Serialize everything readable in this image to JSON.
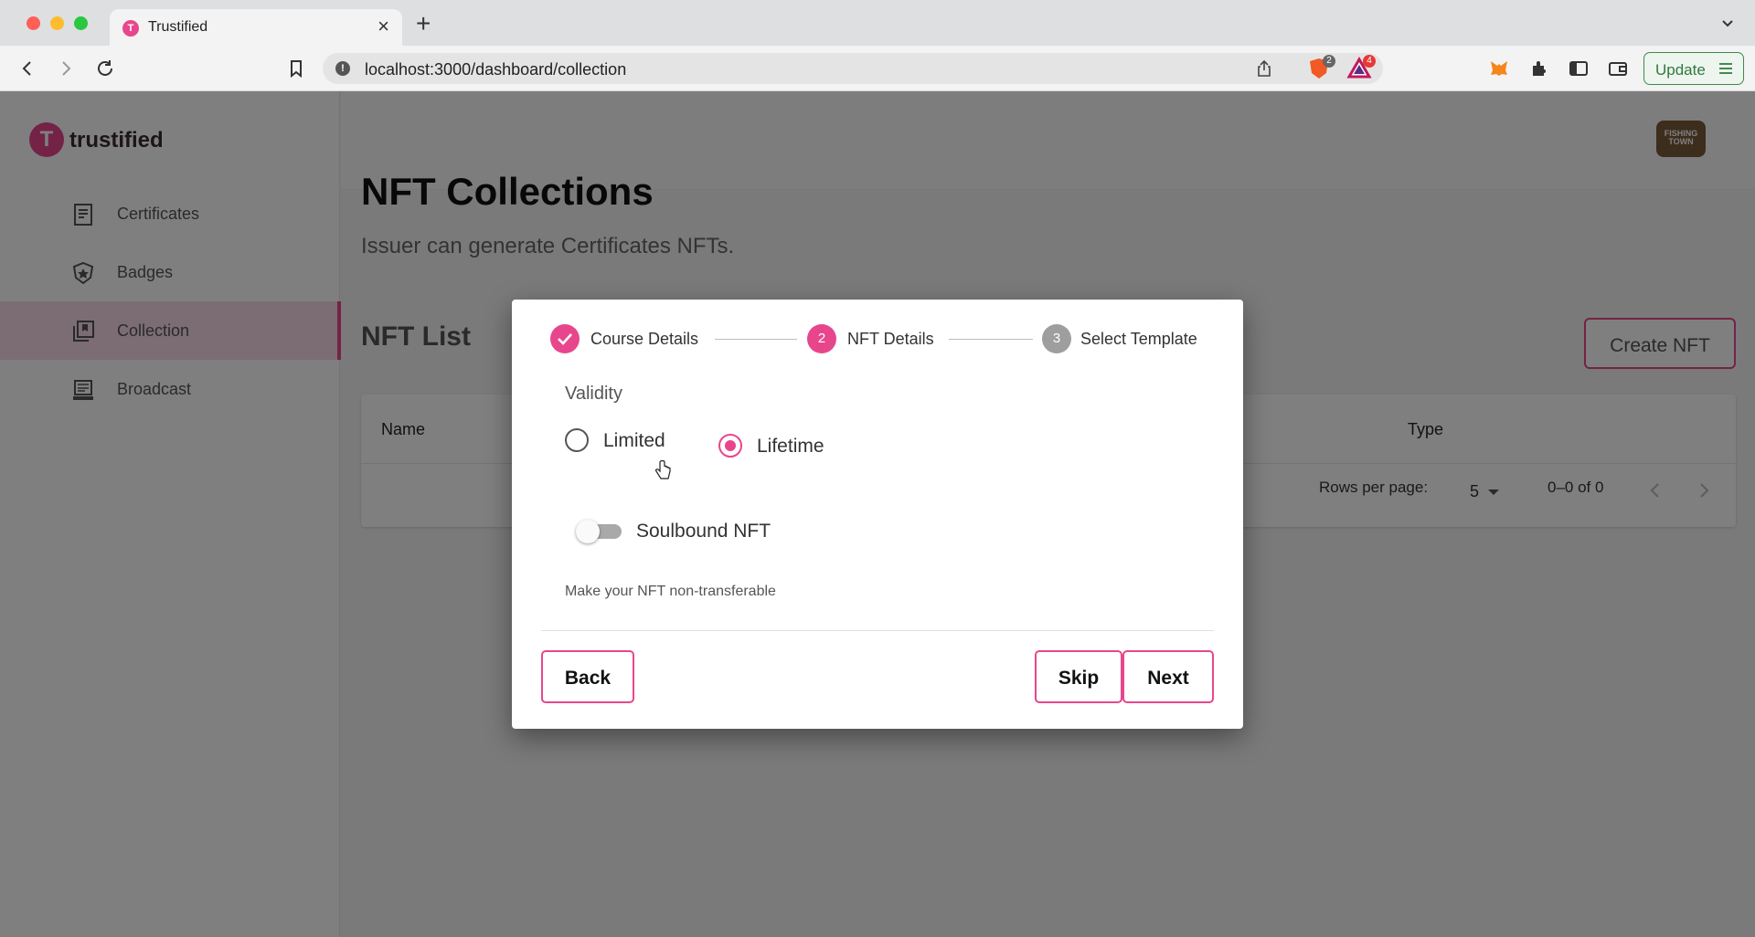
{
  "browser": {
    "tab_title": "Trustified",
    "tab_favicon_letter": "T",
    "url": "localhost:3000/dashboard/collection",
    "brave_shield_count": "2",
    "brave_rewards_count": "4",
    "update_label": "Update",
    "icons": [
      "back-icon",
      "forward-icon",
      "reload-icon",
      "bookmark-icon",
      "info-icon",
      "share-icon",
      "brave-shield-icon",
      "brave-rewards-icon",
      "metamask-icon",
      "extensions-icon",
      "sidebar-icon",
      "wallet-icon",
      "menu-icon",
      "close-icon",
      "plus-icon",
      "chevron-down-icon"
    ]
  },
  "sidebar": {
    "brand_letter": "T",
    "brand_name": "trustified",
    "items": [
      {
        "label": "Certificates",
        "icon": "certificate-icon"
      },
      {
        "label": "Badges",
        "icon": "badge-icon"
      },
      {
        "label": "Collection",
        "icon": "collection-icon",
        "active": true
      },
      {
        "label": "Broadcast",
        "icon": "broadcast-icon"
      }
    ]
  },
  "header": {
    "avatar_text": "FISHING TOWN"
  },
  "main": {
    "title": "NFT Collections",
    "subtitle": "Issuer can generate Certificates NFTs.",
    "list_title": "NFT List",
    "create_button": "Create NFT",
    "table": {
      "columns": [
        "Name",
        "Type"
      ],
      "rows_per_page_label": "Rows per page:",
      "rows_per_page_value": "5",
      "range_text": "0–0 of 0"
    }
  },
  "modal": {
    "steps": [
      {
        "label": "Course Details",
        "state": "completed"
      },
      {
        "number": "2",
        "label": "NFT Details",
        "state": "active"
      },
      {
        "number": "3",
        "label": "Select Template",
        "state": "pending"
      }
    ],
    "validity_label": "Validity",
    "options": [
      {
        "label": "Limited",
        "checked": false
      },
      {
        "label": "Lifetime",
        "checked": true
      }
    ],
    "soulbound_label": "Soulbound NFT",
    "soulbound_on": false,
    "helper_text": "Make your NFT non-transferable",
    "back_label": "Back",
    "skip_label": "Skip",
    "next_label": "Next"
  },
  "colors": {
    "accent": "#e8468c",
    "step_pending": "#9e9e9e",
    "update_green": "#2f7a3d"
  }
}
